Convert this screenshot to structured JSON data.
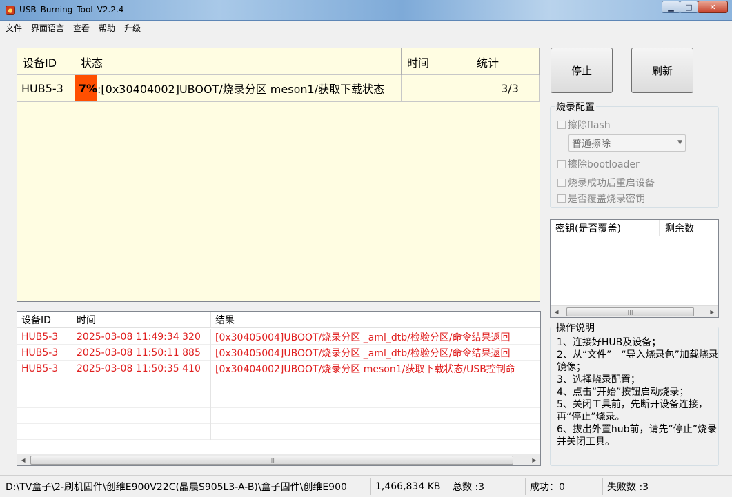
{
  "window": {
    "title": "USB_Burning_Tool_V2.2.4",
    "controls": {
      "minimize": "▁",
      "maximize": "□",
      "close": "✕"
    }
  },
  "menu": [
    "文件",
    "界面语言",
    "查看",
    "帮助",
    "升级"
  ],
  "device_table": {
    "headers": [
      "设备ID",
      "状态",
      "时间",
      "统计"
    ],
    "rows": [
      {
        "device": "HUB5-3",
        "progress": "7%",
        "status": ":[0x30404002]UBOOT/烧录分区 meson1/获取下载状态",
        "time": "",
        "stats": "3/3"
      }
    ]
  },
  "buttons": {
    "stop": "停止",
    "refresh": "刷新"
  },
  "burn_config": {
    "title": "烧录配置",
    "erase_flash": "擦除flash",
    "erase_mode": "普通擦除",
    "erase_bootloader": "擦除bootloader",
    "reboot_after": "烧录成功后重启设备",
    "overwrite_key": "是否覆盖烧录密钥"
  },
  "key_list": {
    "headers": [
      "密钥(是否覆盖)",
      "剩余数"
    ]
  },
  "log_table": {
    "headers": [
      "设备ID",
      "时间",
      "结果"
    ],
    "rows": [
      {
        "device": "HUB5-3",
        "time": "2025-03-08 11:49:34 320",
        "result": "[0x30405004]UBOOT/烧录分区 _aml_dtb/检验分区/命令结果返回"
      },
      {
        "device": "HUB5-3",
        "time": "2025-03-08 11:50:11 885",
        "result": "[0x30405004]UBOOT/烧录分区 _aml_dtb/检验分区/命令结果返回"
      },
      {
        "device": "HUB5-3",
        "time": "2025-03-08 11:50:35 410",
        "result": "[0x30404002]UBOOT/烧录分区 meson1/获取下载状态/USB控制命"
      }
    ]
  },
  "instructions": {
    "title": "操作说明",
    "lines": [
      "1、连接好HUB及设备；",
      "2、从“文件”－“导入烧录包”加载烧录镜像；",
      "3、选择烧录配置；",
      "4、点击“开始”按钮启动烧录；",
      "5、关闭工具前，先断开设备连接，再“停止”烧录。",
      "6、拔出外置hub前，请先“停止”烧录并关闭工具。"
    ]
  },
  "status_bar": {
    "path": "D:\\TV盒子\\2-刷机固件\\创维E900V22C(晶晨S905L3-A-B)\\盒子固件\\创维E900",
    "size": "1,466,834 KB",
    "total": "总数 :3",
    "success": "成功：0",
    "fail": "失败数 :3"
  },
  "colors": {
    "progress": "#ff4f00",
    "log_text": "#e02020",
    "table_bg": "#fffde2"
  }
}
